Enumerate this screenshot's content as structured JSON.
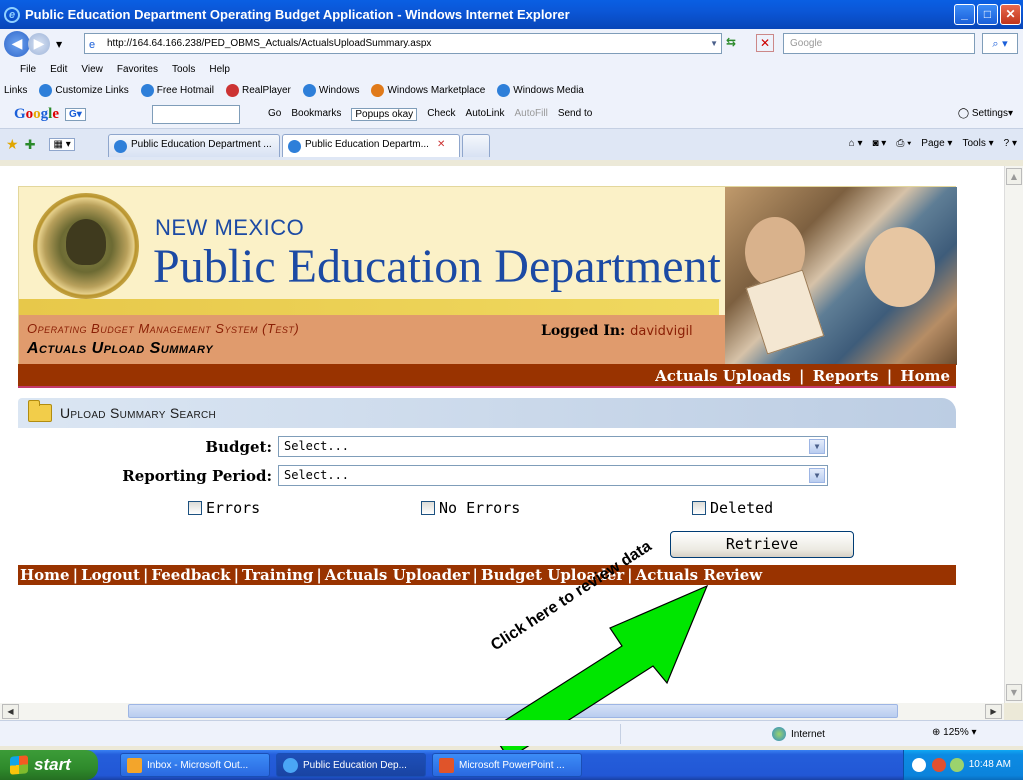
{
  "window": {
    "title": "Public Education Department Operating Budget Application - Windows Internet Explorer"
  },
  "browser": {
    "address": "http://164.64.166.238/PED_OBMS_Actuals/ActualsUploadSummary.aspx",
    "search_placeholder": "Google",
    "menu": [
      "File",
      "Edit",
      "View",
      "Favorites",
      "Tools",
      "Help"
    ],
    "links_label": "Links",
    "links": [
      "Customize Links",
      "Free Hotmail",
      "RealPlayer",
      "Windows",
      "Windows Marketplace",
      "Windows Media"
    ],
    "google_bar": {
      "go": "Go",
      "bookmarks": "Bookmarks",
      "popups": "Popups okay",
      "check": "Check",
      "autolink": "AutoLink",
      "autofill": "AutoFill",
      "send_to": "Send to",
      "settings": "Settings"
    },
    "tabs": [
      {
        "label": "Public Education Department ..."
      },
      {
        "label": "Public Education Departm..."
      }
    ],
    "commands": {
      "page": "Page",
      "tools": "Tools"
    },
    "status": {
      "zone": "Internet",
      "zoom": "125%"
    }
  },
  "banner": {
    "state": "NEW MEXICO",
    "department": "Public Education Department",
    "system": "Operating Budget Management System (Test)",
    "page_title": "Actuals Upload Summary",
    "logged_in_label": "Logged In:",
    "logged_in_user": "davidvigil"
  },
  "top_nav": {
    "actuals_uploads": "Actuals Uploads",
    "reports": "Reports",
    "home": "Home",
    "separator": "|"
  },
  "search_panel": {
    "title": "Upload Summary Search",
    "budget_label": "Budget:",
    "budget_value": "Select...",
    "period_label": "Reporting Period:",
    "period_value": "Select...",
    "errors_label": "Errors",
    "no_errors_label": "No Errors",
    "deleted_label": "Deleted",
    "retrieve_label": "Retrieve"
  },
  "bottom_nav": {
    "home": "Home",
    "logout": "Logout",
    "feedback": "Feedback",
    "training": "Training",
    "actuals_uploader": "Actuals Uploader",
    "budget_uploader": "Budget Uploader",
    "actuals_review": "Actuals Review",
    "separator": "|"
  },
  "annotation": {
    "callout": "Click here to review data",
    "color": "#00e600"
  },
  "taskbar": {
    "start": "start",
    "tasks": [
      {
        "label": "Inbox - Microsoft Out..."
      },
      {
        "label": "Public Education Dep..."
      },
      {
        "label": "Microsoft PowerPoint ..."
      }
    ],
    "clock": "10:48 AM"
  }
}
